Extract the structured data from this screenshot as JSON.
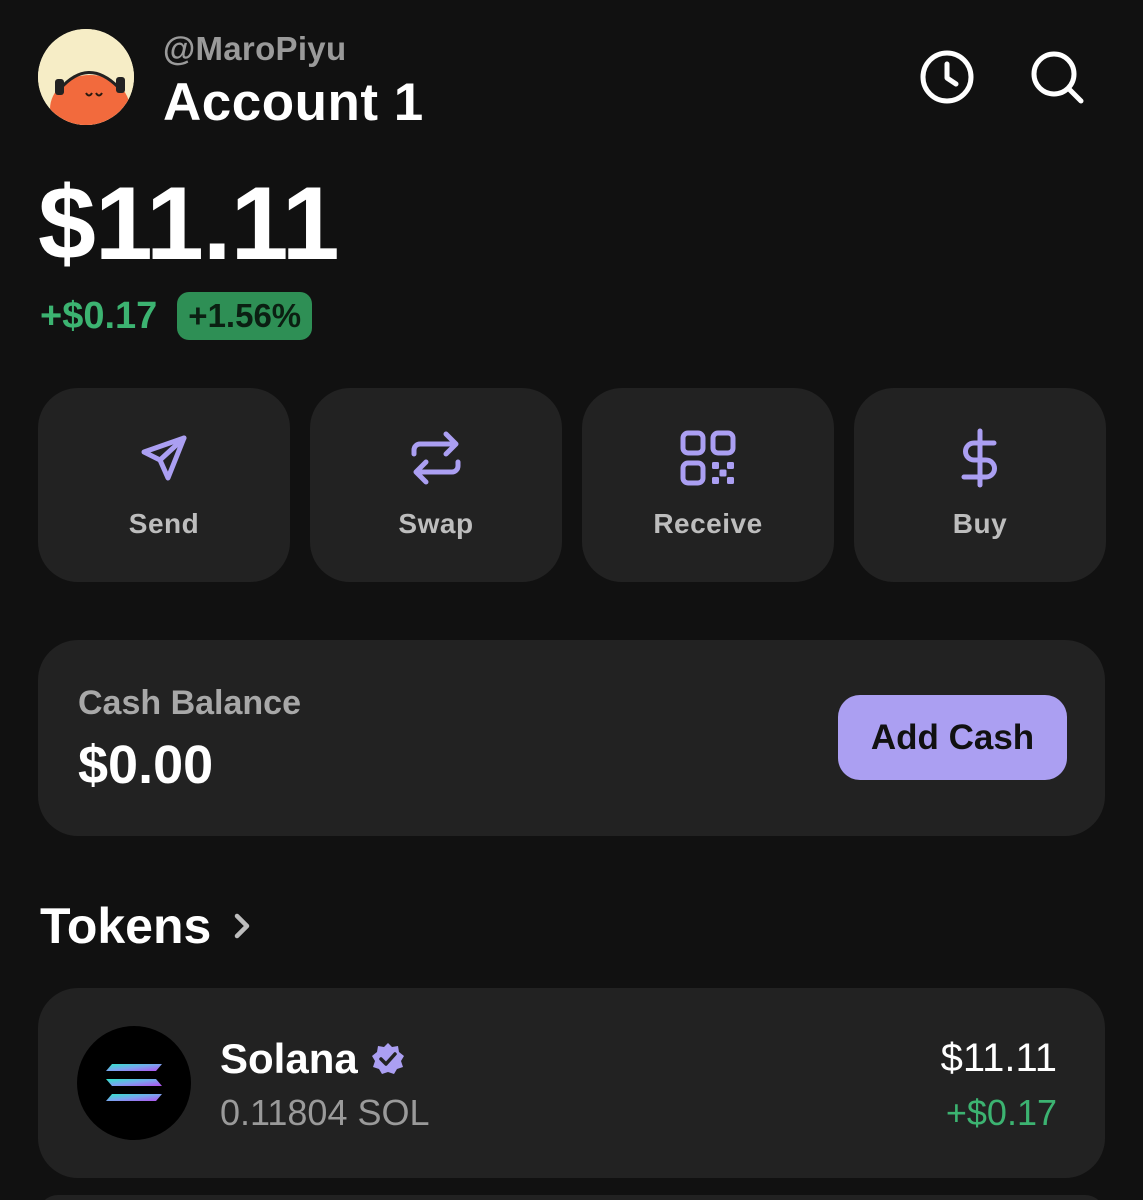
{
  "header": {
    "handle": "@MaroPiyu",
    "account_name": "Account 1",
    "history_icon": "clock-icon",
    "search_icon": "search-icon"
  },
  "portfolio": {
    "balance": "$11.11",
    "change_amount": "+$0.17",
    "change_percent": "+1.56%",
    "positive_color": "#3cb371"
  },
  "actions": [
    {
      "label": "Send",
      "icon": "send-icon"
    },
    {
      "label": "Swap",
      "icon": "swap-icon"
    },
    {
      "label": "Receive",
      "icon": "qr-code-icon"
    },
    {
      "label": "Buy",
      "icon": "dollar-icon"
    }
  ],
  "cash": {
    "label": "Cash Balance",
    "value": "$0.00",
    "button_label": "Add Cash"
  },
  "tokens": {
    "title": "Tokens",
    "items": [
      {
        "name": "Solana",
        "amount": "0.11804 SOL",
        "value": "$11.11",
        "change": "+$0.17",
        "verified": true,
        "icon": "solana-logo-icon"
      }
    ]
  },
  "theme": {
    "accent": "#ab9ff2",
    "background": "#111111",
    "card": "#222222"
  }
}
